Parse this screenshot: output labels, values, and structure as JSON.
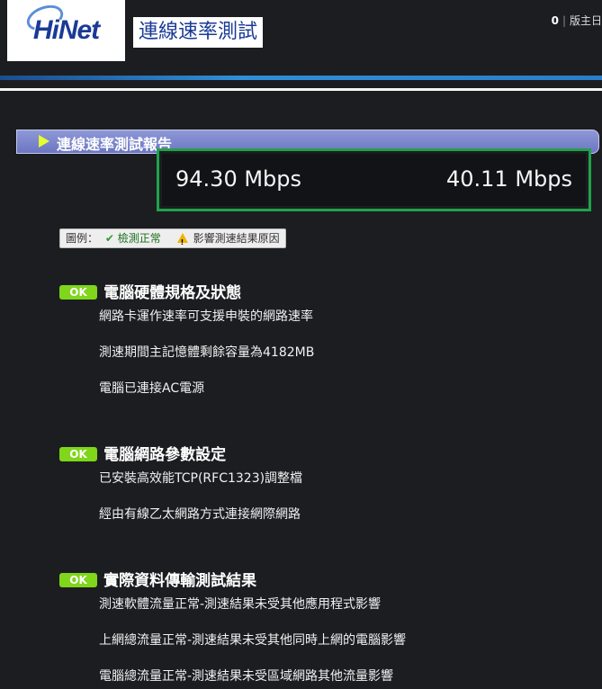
{
  "header": {
    "logo_text": "HiNet",
    "page_title": "連線速率測試",
    "count": "0",
    "separator": "|",
    "link": "版主日"
  },
  "report": {
    "title": "連線速率測試報告",
    "download_speed": "94.30 Mbps",
    "upload_speed": "40.11 Mbps"
  },
  "legend": {
    "label": "圖例：",
    "ok_label": "檢測正常",
    "warn_label": "影響測速結果原因"
  },
  "sections": [
    {
      "badge": "OK",
      "title": "電腦硬體規格及狀態",
      "items": [
        "網路卡運作速率可支援申裝的網路速率",
        "測速期間主記憶體剩餘容量為4182MB",
        "電腦已連接AC電源"
      ]
    },
    {
      "badge": "OK",
      "title": "電腦網路參數設定",
      "items": [
        "已安裝高效能TCP(RFC1323)調整檔",
        "經由有線乙太網路方式連接網際網路"
      ]
    },
    {
      "badge": "OK",
      "title": "實際資料傳輸測試結果",
      "items": [
        "測速軟體流量正常-測速結果未受其他應用程式影響",
        "上網總流量正常-測速結果未受其他同時上網的電腦影響",
        "電腦總流量正常-測速結果未受區域網路其他流量影響"
      ]
    }
  ],
  "colors": {
    "background": "#1c1d21",
    "ok_badge": "#7fd61a",
    "highlight_border": "#20a24a",
    "header_bar": "#7a84cc",
    "brand_blue": "#1a3a96"
  }
}
